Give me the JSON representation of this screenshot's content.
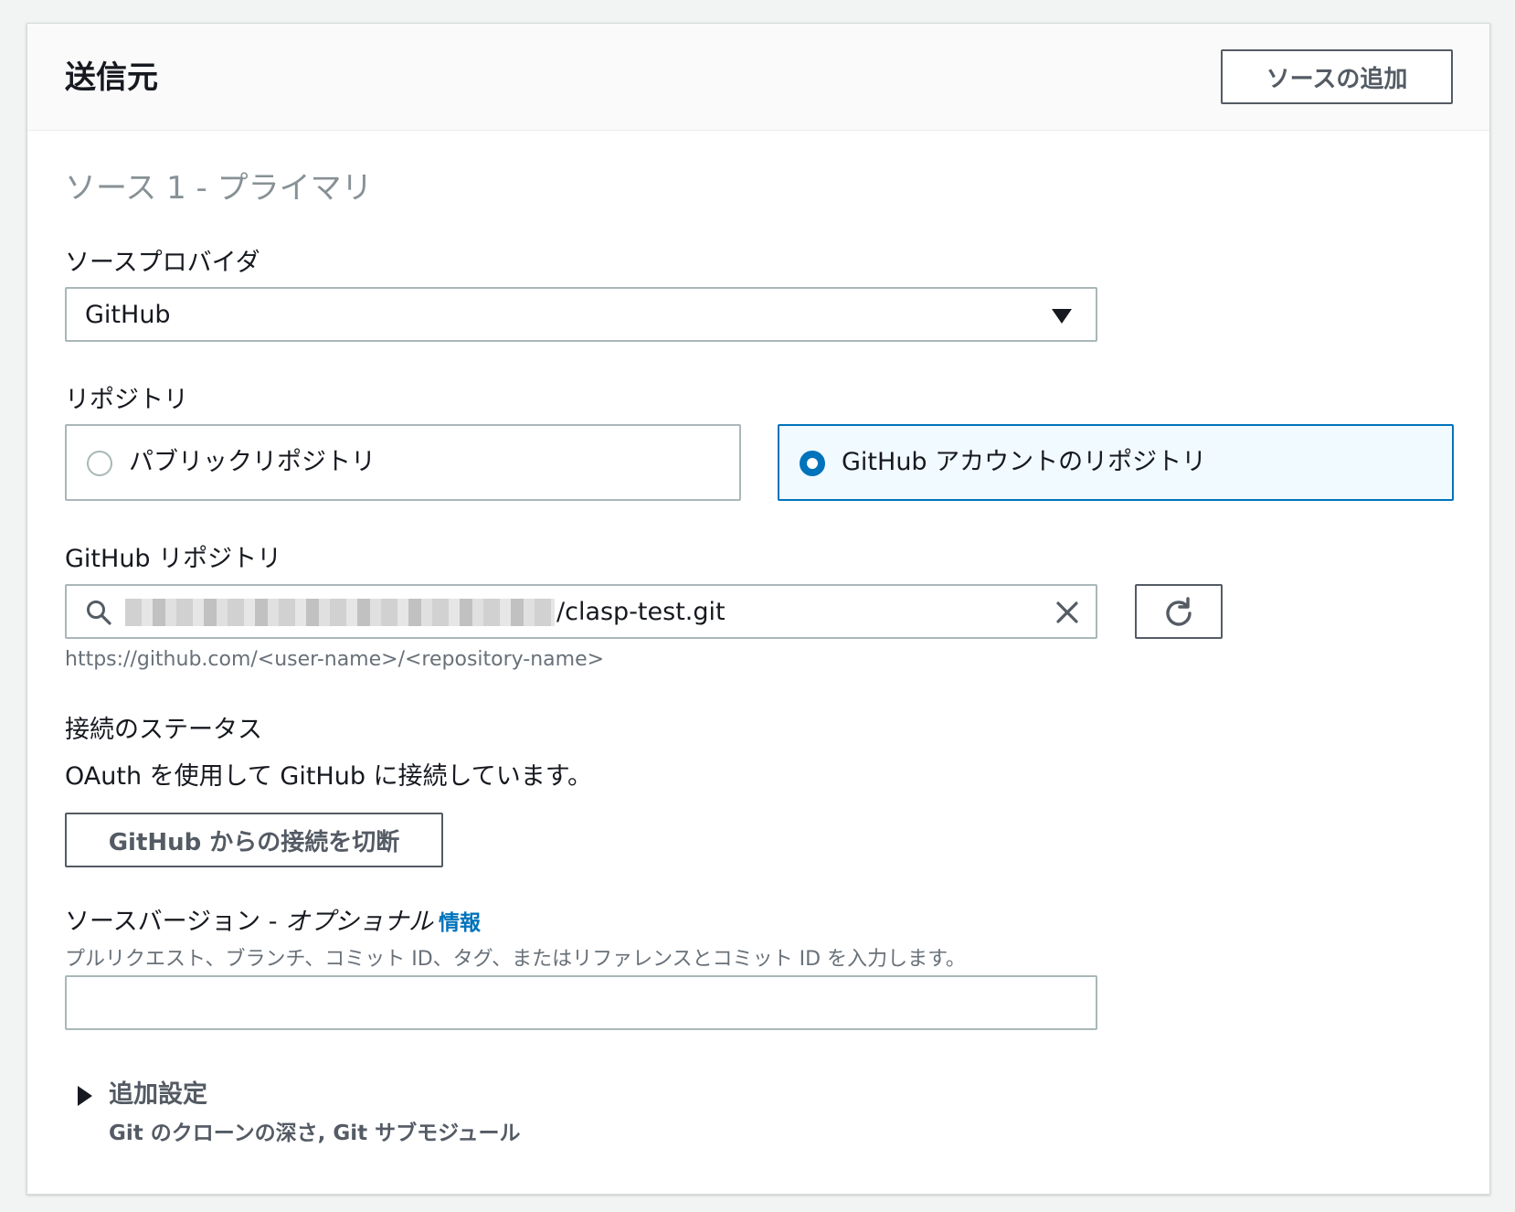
{
  "panel": {
    "title": "送信元",
    "add_source_label": "ソースの追加"
  },
  "source": {
    "title": "ソース 1 - プライマリ",
    "provider_label": "ソースプロバイダ",
    "provider_value": "GitHub",
    "repository_label": "リポジトリ",
    "repository_options": [
      {
        "label": "パブリックリポジトリ",
        "selected": false
      },
      {
        "label": "GitHub アカウントのリポジトリ",
        "selected": true
      }
    ],
    "github_repo_label": "GitHub リポジトリ",
    "github_repo_value": "/clasp-test.git",
    "github_repo_hint": "https://github.com/<user-name>/<repository-name>",
    "connection_label": "接続のステータス",
    "connection_status": "OAuth を使用して GitHub に接続しています。",
    "disconnect_label": "GitHub からの接続を切断",
    "version_label": "ソースバージョン - ",
    "version_optional": "オプショナル",
    "version_info": "情報",
    "version_hint": "プルリクエスト、ブランチ、コミット ID、タグ、またはリファレンスとコミット ID を入力します。",
    "version_value": "",
    "additional_title": "追加設定",
    "additional_desc": "Git のクローンの深さ, Git サブモジュール"
  },
  "icons": {
    "search": "search-icon",
    "clear": "close-icon",
    "refresh": "refresh-icon",
    "dropdown": "caret-down-icon",
    "expander": "caret-right-icon"
  },
  "colors": {
    "accent": "#0073bb",
    "selected_tile_bg": "#f1faff",
    "border": "#aab7b8",
    "button_text": "#545b64"
  }
}
